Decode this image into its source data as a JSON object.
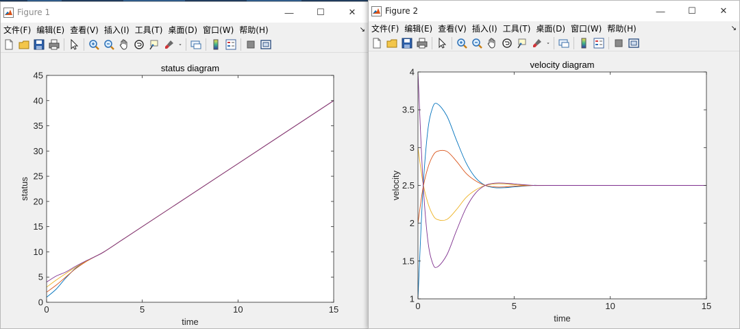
{
  "desktop": {
    "tabs": [
      "",
      "",
      "",
      ""
    ]
  },
  "figure1": {
    "window_title": "Figure 1",
    "menu": [
      "文件(F)",
      "编辑(E)",
      "查看(V)",
      "插入(I)",
      "工具(T)",
      "桌面(D)",
      "窗口(W)",
      "帮助(H)"
    ],
    "toolbar_icons": [
      "new-figure-icon",
      "open-file-icon",
      "save-icon",
      "print-icon",
      "pointer-icon",
      "zoom-in-icon",
      "zoom-out-icon",
      "pan-hand-icon",
      "rotate-3d-icon",
      "data-cursor-icon",
      "brush-icon",
      "dropdown-arrow-icon",
      "link-plot-icon",
      "colorbar-icon",
      "legend-icon",
      "hide-plot-tools-icon",
      "show-plot-tools-icon"
    ]
  },
  "figure2": {
    "window_title": "Figure 2",
    "menu": [
      "文件(F)",
      "编辑(E)",
      "查看(V)",
      "插入(I)",
      "工具(T)",
      "桌面(D)",
      "窗口(W)",
      "帮助(H)"
    ],
    "toolbar_icons": [
      "new-figure-icon",
      "open-file-icon",
      "save-icon",
      "print-icon",
      "pointer-icon",
      "zoom-in-icon",
      "zoom-out-icon",
      "pan-hand-icon",
      "rotate-3d-icon",
      "data-cursor-icon",
      "brush-icon",
      "dropdown-arrow-icon",
      "link-plot-icon",
      "colorbar-icon",
      "legend-icon",
      "hide-plot-tools-icon",
      "show-plot-tools-icon"
    ]
  },
  "window_controls": {
    "minimize": "—",
    "maximize": "☐",
    "close": "✕"
  },
  "colors": {
    "c1": "#0072bd",
    "c2": "#d95319",
    "c3": "#edb120",
    "c4": "#7e2f8e"
  },
  "chart_data": [
    {
      "type": "line",
      "title": "status diagram",
      "xlabel": "time",
      "ylabel": "status",
      "xlim": [
        0,
        15
      ],
      "ylim": [
        0,
        45
      ],
      "xticks": [
        0,
        5,
        10,
        15
      ],
      "yticks": [
        0,
        5,
        10,
        15,
        20,
        25,
        30,
        35,
        40,
        45
      ],
      "grid": false,
      "legend": "none",
      "series": [
        {
          "x": [
            0,
            0.5,
            1,
            1.5,
            2,
            2.5,
            3,
            4,
            5,
            15
          ],
          "values": [
            1,
            2.6,
            4.8,
            6.7,
            8.0,
            9.0,
            10.0,
            12.5,
            15.0,
            40.0
          ]
        },
        {
          "x": [
            0,
            0.5,
            1,
            1.5,
            2,
            2.5,
            3,
            4,
            5,
            15
          ],
          "values": [
            2,
            3.4,
            5.0,
            6.6,
            7.9,
            9.0,
            10.0,
            12.5,
            15.0,
            40.0
          ]
        },
        {
          "x": [
            0,
            0.5,
            1,
            1.5,
            2,
            2.5,
            3,
            4,
            5,
            15
          ],
          "values": [
            3,
            4.4,
            5.7,
            6.9,
            8.0,
            9.0,
            10.0,
            12.5,
            15.0,
            40.0
          ]
        },
        {
          "x": [
            0,
            0.5,
            1,
            1.5,
            2,
            2.5,
            3,
            4,
            5,
            15
          ],
          "values": [
            4,
            5.2,
            6.0,
            7.1,
            8.1,
            9.0,
            10.0,
            12.5,
            15.0,
            40.0
          ]
        }
      ]
    },
    {
      "type": "line",
      "title": "velocity diagram",
      "xlabel": "time",
      "ylabel": "velocity",
      "xlim": [
        0,
        15
      ],
      "ylim": [
        1,
        4
      ],
      "xticks": [
        0,
        5,
        10,
        15
      ],
      "yticks": [
        1,
        1.5,
        2,
        2.5,
        3,
        3.5,
        4
      ],
      "grid": false,
      "legend": "none",
      "series": [
        {
          "x": [
            0,
            0.25,
            0.5,
            0.75,
            1,
            1.5,
            2,
            2.5,
            3,
            3.5,
            4,
            4.5,
            5,
            6,
            7,
            15
          ],
          "values": [
            1,
            2.4,
            3.2,
            3.52,
            3.58,
            3.42,
            3.1,
            2.8,
            2.6,
            2.5,
            2.47,
            2.47,
            2.48,
            2.5,
            2.5,
            2.5
          ]
        },
        {
          "x": [
            0,
            0.25,
            0.5,
            0.75,
            1,
            1.5,
            2,
            2.5,
            3,
            3.5,
            4,
            4.5,
            5,
            6,
            7,
            15
          ],
          "values": [
            2,
            2.45,
            2.72,
            2.88,
            2.95,
            2.95,
            2.82,
            2.66,
            2.56,
            2.5,
            2.48,
            2.48,
            2.49,
            2.5,
            2.5,
            2.5
          ]
        },
        {
          "x": [
            0,
            0.25,
            0.5,
            0.75,
            1,
            1.5,
            2,
            2.5,
            3,
            3.5,
            4,
            4.5,
            5,
            6,
            7,
            15
          ],
          "values": [
            3,
            2.55,
            2.28,
            2.12,
            2.05,
            2.05,
            2.18,
            2.34,
            2.44,
            2.5,
            2.52,
            2.52,
            2.51,
            2.5,
            2.5,
            2.5
          ]
        },
        {
          "x": [
            0,
            0.25,
            0.5,
            0.75,
            1,
            1.5,
            2,
            2.5,
            3,
            3.5,
            4,
            4.5,
            5,
            6,
            7,
            15
          ],
          "values": [
            4,
            2.6,
            1.8,
            1.48,
            1.42,
            1.58,
            1.9,
            2.2,
            2.4,
            2.5,
            2.53,
            2.53,
            2.52,
            2.5,
            2.5,
            2.5
          ]
        }
      ]
    }
  ]
}
